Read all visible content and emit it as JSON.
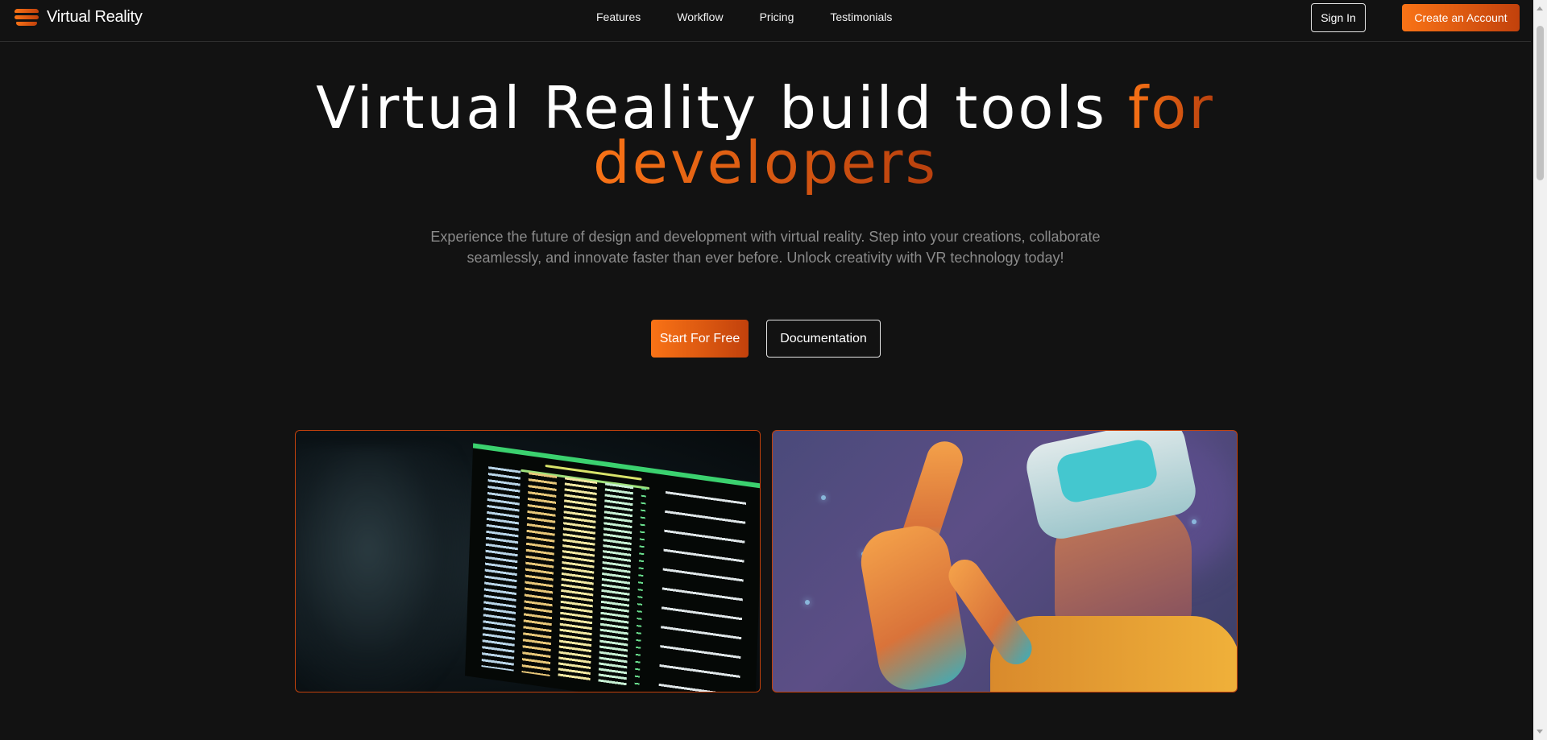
{
  "header": {
    "brand": "Virtual Reality",
    "nav": [
      "Features",
      "Workflow",
      "Pricing",
      "Testimonials"
    ],
    "sign_in": "Sign In",
    "create_account": "Create an Account"
  },
  "hero": {
    "title_main": "Virtual Reality build tools ",
    "title_accent_1": "for",
    "title_accent_2": "developers",
    "subtitle": "Experience the future of design and development with virtual reality. Step into your creations, collaborate seamlessly, and innovate faster than ever before. Unlock creativity with VR technology today!",
    "cta_primary": "Start For Free",
    "cta_secondary": "Documentation"
  },
  "images": {
    "left": "terminal-monitor-image",
    "right": "vr-headset-person-image"
  },
  "colors": {
    "accent": "#f97316",
    "accent_dark": "#c2410c",
    "background": "#121212"
  }
}
